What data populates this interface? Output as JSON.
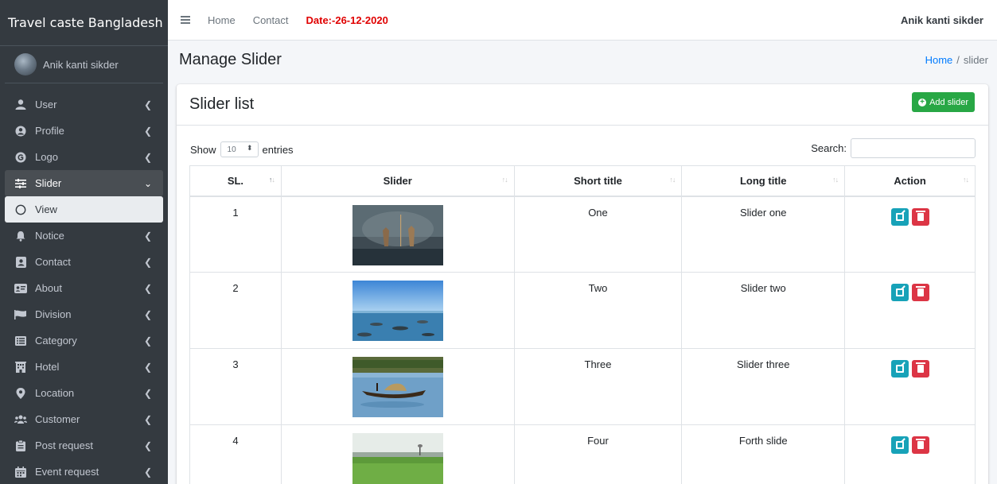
{
  "brand": "Travel caste Bangladesh",
  "sidebar_user": "Anik kanti sikder",
  "sidebar": {
    "items": [
      {
        "label": "User",
        "icon": "user-icon"
      },
      {
        "label": "Profile",
        "icon": "profile-icon"
      },
      {
        "label": "Logo",
        "icon": "logo-icon"
      },
      {
        "label": "Slider",
        "icon": "sliders-icon"
      },
      {
        "label": "View",
        "icon": "circle-icon"
      },
      {
        "label": "Notice",
        "icon": "bell-icon"
      },
      {
        "label": "Contact",
        "icon": "contact-icon"
      },
      {
        "label": "About",
        "icon": "id-card-icon"
      },
      {
        "label": "Division",
        "icon": "flag-icon"
      },
      {
        "label": "Category",
        "icon": "list-icon"
      },
      {
        "label": "Hotel",
        "icon": "hotel-icon"
      },
      {
        "label": "Location",
        "icon": "map-marker-icon"
      },
      {
        "label": "Customer",
        "icon": "users-icon"
      },
      {
        "label": "Post request",
        "icon": "clipboard-icon"
      },
      {
        "label": "Event request",
        "icon": "calendar-icon"
      }
    ]
  },
  "topbar": {
    "home": "Home",
    "contact": "Contact",
    "date": "Date:-26-12-2020",
    "user": "Anik kanti sikder"
  },
  "page": {
    "title": "Manage Slider",
    "breadcrumb_home": "Home",
    "breadcrumb_sep": "/",
    "breadcrumb_current": "slider"
  },
  "card": {
    "title": "Slider list",
    "add_button": "Add slider",
    "show_label": "Show",
    "entries_value": "10",
    "entries_label": "entries",
    "search_label": "Search:"
  },
  "table": {
    "headers": [
      "SL.",
      "Slider",
      "Short title",
      "Long title",
      "Action"
    ],
    "rows": [
      {
        "sl": "1",
        "short": "One",
        "long": "Slider one"
      },
      {
        "sl": "2",
        "short": "Two",
        "long": "Slider two"
      },
      {
        "sl": "3",
        "short": "Three",
        "long": "Slider three"
      },
      {
        "sl": "4",
        "short": "Four",
        "long": "Forth slide"
      }
    ]
  },
  "colors": {
    "sidebar_bg": "#343a40",
    "accent_green": "#28a745",
    "edit_blue": "#17a2b8",
    "delete_red": "#dc3545",
    "date_red": "#e00000",
    "link_blue": "#007bff"
  }
}
